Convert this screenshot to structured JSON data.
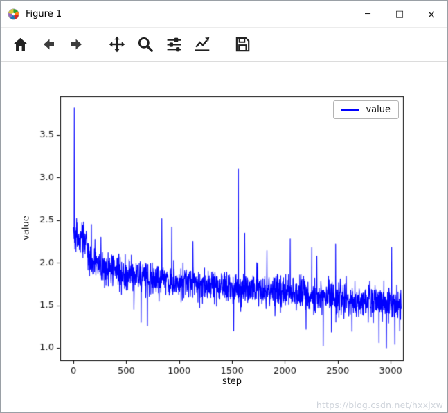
{
  "window": {
    "title": "Figure 1"
  },
  "icons": {
    "minimize": "─",
    "maximize": "□",
    "close": "×"
  },
  "toolbar": {
    "items": [
      "home",
      "back",
      "forward",
      "pan",
      "zoom",
      "configure-subplots",
      "edit-axis",
      "save"
    ]
  },
  "chart_data": {
    "type": "line",
    "title": "",
    "xlabel": "step",
    "ylabel": "value",
    "legend": {
      "label": "value",
      "position": "upper right"
    },
    "line_color": "#0000ff",
    "grid": false,
    "xlim": [
      -125,
      3117
    ],
    "ylim": [
      0.853,
      3.956
    ],
    "x_ticks": [
      0,
      500,
      1000,
      1500,
      2000,
      2500,
      3000
    ],
    "y_ticks": [
      1.0,
      1.5,
      2.0,
      2.5,
      3.0,
      3.5
    ],
    "series": [
      {
        "name": "value",
        "n_points": 3100,
        "x_step": 2,
        "seed": 42,
        "trend": [
          [
            0,
            2.32
          ],
          [
            110,
            2.26
          ],
          [
            160,
            2.0
          ],
          [
            300,
            1.93
          ],
          [
            500,
            1.87
          ],
          [
            800,
            1.8
          ],
          [
            1100,
            1.76
          ],
          [
            1400,
            1.72
          ],
          [
            1700,
            1.68
          ],
          [
            2000,
            1.65
          ],
          [
            2300,
            1.62
          ],
          [
            2600,
            1.58
          ],
          [
            2900,
            1.54
          ],
          [
            3100,
            1.5
          ]
        ],
        "noise_amplitude": 0.17,
        "spikes": [
          [
            8,
            3.82
          ],
          [
            30,
            2.52
          ],
          [
            95,
            2.48
          ],
          [
            170,
            2.45
          ],
          [
            260,
            2.3
          ],
          [
            930,
            2.42
          ],
          [
            1130,
            2.25
          ],
          [
            1560,
            3.1
          ],
          [
            1620,
            2.35
          ],
          [
            2050,
            2.28
          ],
          [
            2480,
            2.22
          ],
          [
            3010,
            2.18
          ]
        ],
        "dips": [
          [
            640,
            1.3
          ],
          [
            700,
            1.26
          ],
          [
            1515,
            1.2
          ],
          [
            2200,
            1.22
          ],
          [
            2890,
            1.06
          ],
          [
            2960,
            1.0
          ],
          [
            3040,
            1.04
          ],
          [
            3085,
            1.2
          ]
        ]
      }
    ]
  },
  "watermark": {
    "text": "https://blog.csdn.net/hxxjxw"
  }
}
